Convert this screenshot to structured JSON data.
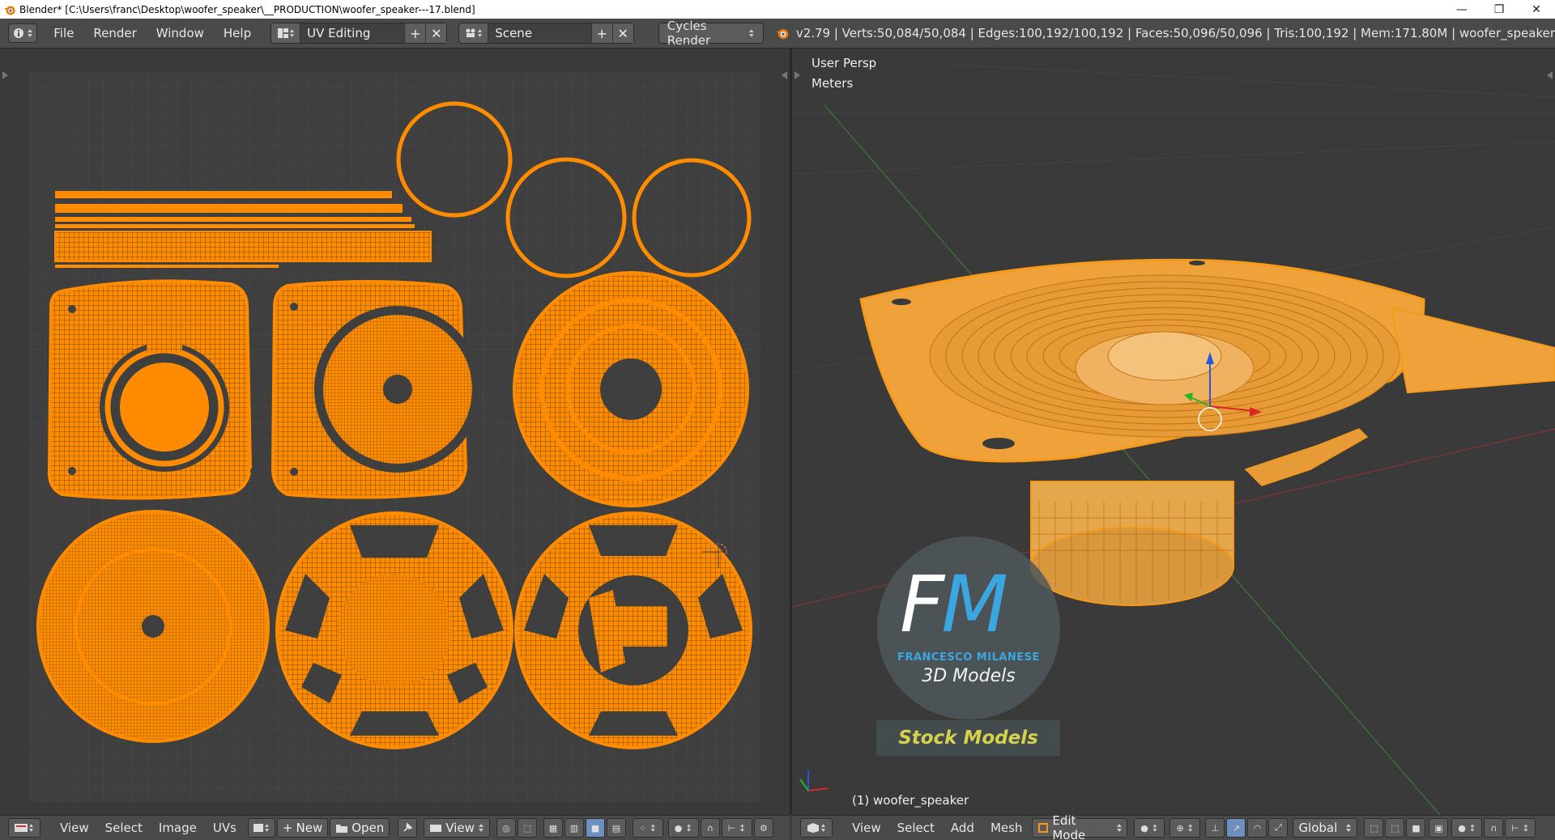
{
  "window": {
    "title": "Blender* [C:\\Users\\franc\\Desktop\\woofer_speaker\\__PRODUCTION\\woofer_speaker---17.blend]",
    "minimize_glyph": "—",
    "restore_glyph": "❐",
    "close_glyph": "✕"
  },
  "info_header": {
    "menus": [
      "File",
      "Render",
      "Window",
      "Help"
    ],
    "screen_layout": "UV Editing",
    "scene": "Scene",
    "render_engine": "Cycles Render",
    "stats": "v2.79 | Verts:50,084/50,084 | Edges:100,192/100,192 | Faces:50,096/50,096 | Tris:100,192 | Mem:171.80M | woofer_speaker"
  },
  "uv_editor": {
    "menus": [
      "View",
      "Select",
      "Image",
      "UVs"
    ],
    "new_label": "New",
    "open_label": "Open",
    "view_label": "View"
  },
  "viewport": {
    "perspective_label": "User Persp",
    "units_label": "Meters",
    "object_label": "(1) woofer_speaker",
    "menus": [
      "View",
      "Select",
      "Add",
      "Mesh"
    ],
    "mode": "Edit Mode",
    "orientation": "Global"
  },
  "watermark": {
    "letters_f": "F",
    "letters_m": "M",
    "name": "FRANCESCO MILANESE",
    "tagline": "3D Models",
    "stock": "Stock Models"
  },
  "colors": {
    "uv_orange": "#ff8c00",
    "mesh_orange": "#f59a1a",
    "grid_bg": "#3c3c3c",
    "accent_blue": "#3aa7e0"
  }
}
